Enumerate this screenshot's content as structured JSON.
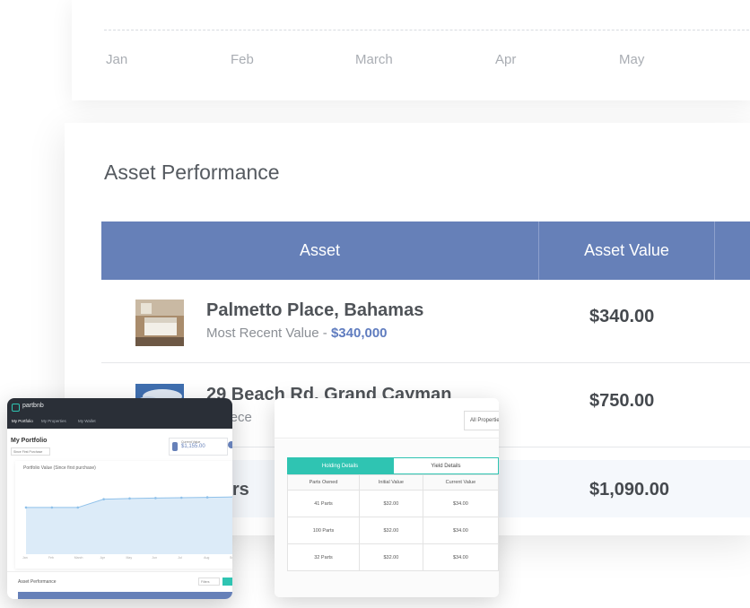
{
  "top_chart": {
    "months": [
      "Jan",
      "Feb",
      "March",
      "Apr",
      "May"
    ]
  },
  "asset_performance": {
    "title": "Asset Performance",
    "columns": [
      "Asset",
      "Asset Value"
    ],
    "rows": [
      {
        "name": "Palmetto Place, Bahamas",
        "sub_label": "Most Recent Value - ",
        "sub_value": "$340,000",
        "value": "$340.00"
      },
      {
        "name": "29 Beach Rd, Grand Cayman",
        "sub_label": "Most Recent Value - ",
        "sub_value": "",
        "value": "$750.00"
      },
      {
        "name": "e firs",
        "sub_label": "",
        "sub_value": "",
        "value": "$1,090.00"
      }
    ],
    "row1_partial_sub": "st Rece"
  },
  "phone": {
    "brand": "partbnb",
    "nav": [
      "My Portfolio",
      "My Properties",
      "My Wallet"
    ],
    "title": "My Portfolio",
    "select": "Since First Purchase",
    "value_label": "Current Value",
    "value": "$1,155.00",
    "chart_title": "Portfolio Value (Since first purchase)",
    "chart_months": [
      "Jan",
      "Feb",
      "March",
      "Apr",
      "May",
      "Jun",
      "Jul",
      "Aug",
      "Sep"
    ],
    "chart_values": [
      0.62,
      0.62,
      0.62,
      0.73,
      0.74,
      0.745,
      0.75,
      0.755,
      0.76
    ],
    "asset_title": "Asset Performance",
    "filter": "Filters"
  },
  "holding": {
    "select": "All Properties",
    "tabs": [
      "Holding Details",
      "Yield Details"
    ],
    "columns": [
      "Parts Owned",
      "Initial Value",
      "Current Value"
    ],
    "rows": [
      [
        "41 Parts",
        "$32.00",
        "$34.00"
      ],
      [
        "100 Parts",
        "$32.00",
        "$34.00"
      ],
      [
        "32 Parts",
        "$32.00",
        "$34.00"
      ]
    ]
  }
}
